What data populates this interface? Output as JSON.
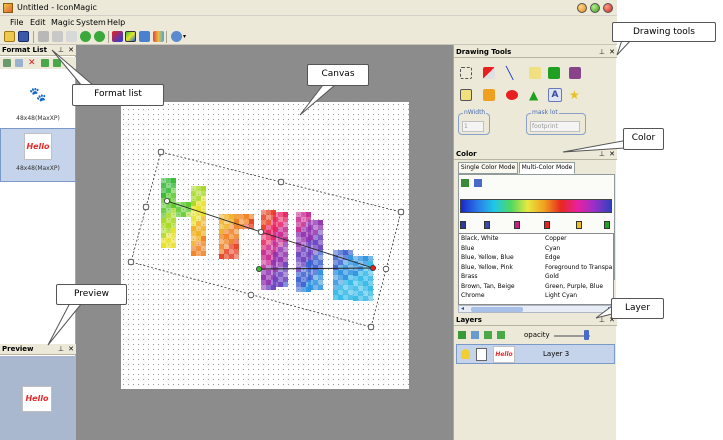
{
  "window": {
    "title": "Untitled - IconMagic"
  },
  "menu": [
    "File",
    "Edit",
    "Magic",
    "System",
    "Help"
  ],
  "panels": {
    "format_list": {
      "title": "Format List",
      "items": [
        "48x48(MaxXP)",
        "48x48(MaxXP)"
      ]
    },
    "preview": {
      "title": "Preview"
    },
    "drawing_tools": {
      "title": "Drawing Tools",
      "nwidth_label": "nWidth",
      "nwidth_value": "1",
      "mask_label": "mask lot",
      "mask_value": "footprint"
    },
    "color": {
      "title": "Color",
      "tab_single": "Single Color Mode",
      "tab_multi": "Multi-Color Mode",
      "gradient": [
        "#1a28c8",
        "#2a7ae8",
        "#20c8e8",
        "#50d860",
        "#e8e840",
        "#f0a020",
        "#e82820",
        "#e820a0",
        "#9830c8",
        "#3040c0"
      ],
      "palette_left": [
        "Black, White",
        "Blue",
        "Blue, Yellow, Blue",
        "Blue, Yellow, Pink",
        "Brass",
        "Brown, Tan, Beige",
        "Chrome"
      ],
      "palette_right": [
        "Copper",
        "Cyan",
        "Edge",
        "Foreground to Transpa",
        "Gold",
        "Green, Purple, Blue",
        "Light Cyan"
      ]
    },
    "layers": {
      "title": "Layers",
      "opacity_label": "opacity",
      "layer_name": "Layer 3"
    }
  },
  "thumbnail_text": "Hello",
  "callouts": {
    "drawing_tools": "Drawing tools",
    "canvas": "Canvas",
    "format_list": "Format list",
    "color": "Color",
    "preview": "Preview",
    "layer": "Layer"
  },
  "colors": {
    "chrome": "#ece9d8",
    "canvas_bg": "#8c8c8c",
    "selection": "#c5d4ea",
    "preview_bg": "#a9b7cf"
  }
}
